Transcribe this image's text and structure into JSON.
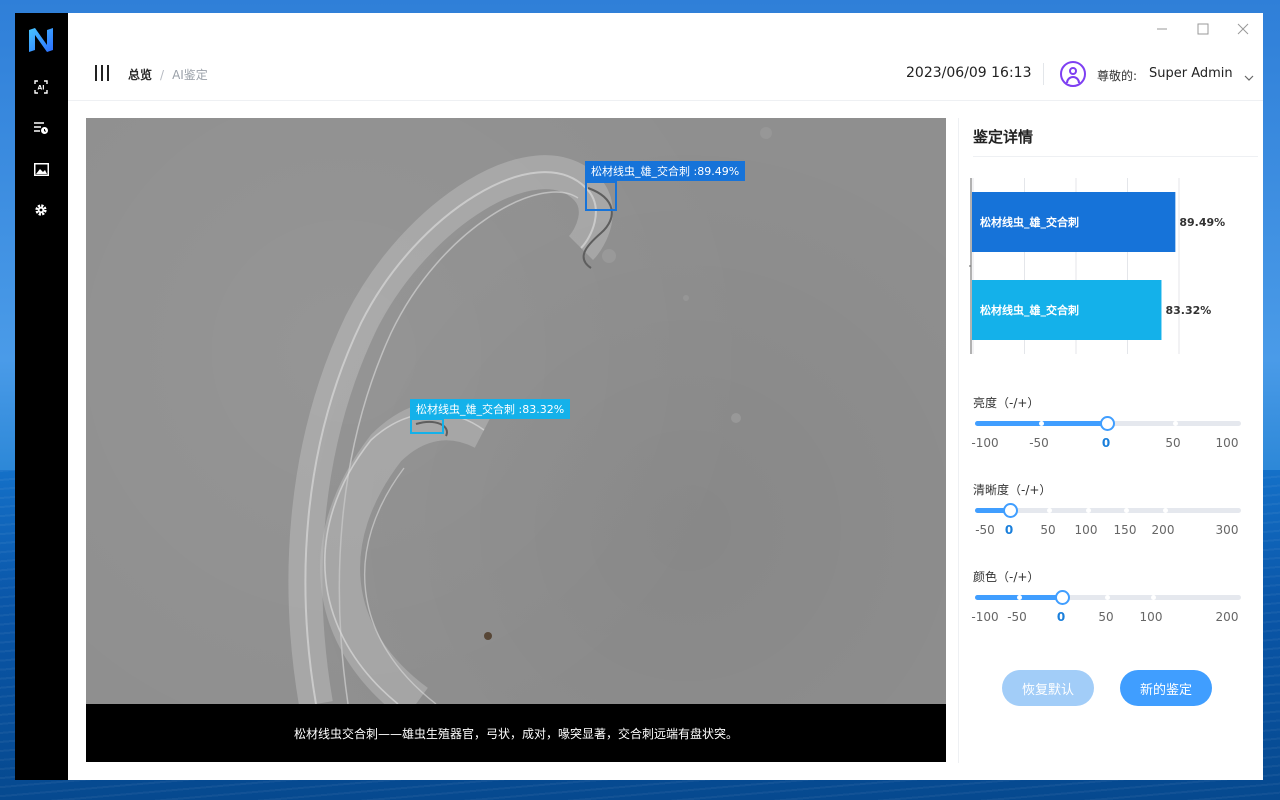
{
  "header": {
    "breadcrumb": [
      "总览",
      "AI鉴定"
    ],
    "datetime": "2023/06/09 16:13",
    "user_greeting": "尊敬的:",
    "user_name": "Super Admin"
  },
  "sidebar": {
    "items": [
      {
        "icon": "ai-scan-icon"
      },
      {
        "icon": "history-list-icon"
      },
      {
        "icon": "image-icon"
      },
      {
        "icon": "gear-icon"
      }
    ]
  },
  "window_controls": [
    "minimize-icon",
    "maximize-icon",
    "close-icon"
  ],
  "viewer": {
    "detections": [
      {
        "label": "松材线虫_雄_交合刺 :89.49%",
        "color": "#1673d9"
      },
      {
        "label": "松材线虫_雄_交合刺 :83.32%",
        "color": "#14b1ea"
      }
    ],
    "caption": "松材线虫交合刺——雄虫生殖器官，弓状，成对，喙突显著，交合刺远端有盘状突。"
  },
  "panel": {
    "title": "鉴定详情",
    "sliders": [
      {
        "label": "亮度（-/+）",
        "ticks": [
          "-100",
          "-50",
          "0",
          "50",
          "100"
        ],
        "value": 0,
        "active_tick": "0"
      },
      {
        "label": "清晰度（-/+）",
        "ticks": [
          "-50",
          "0",
          "50",
          "100",
          "150",
          "200",
          "300"
        ],
        "value": 0,
        "active_tick": "0"
      },
      {
        "label": "颜色（-/+）",
        "ticks": [
          "-100",
          "-50",
          "0",
          "50",
          "100",
          "200"
        ],
        "value": 0,
        "active_tick": "0"
      }
    ],
    "buttons": {
      "reset": "恢复默认",
      "new": "新的鉴定"
    }
  },
  "chart_data": {
    "type": "bar",
    "orientation": "horizontal",
    "categories": [
      "松材线虫_雄_交合刺",
      "松材线虫_雄_交合刺"
    ],
    "values": [
      89.49,
      83.32
    ],
    "value_labels": [
      "89.49%",
      "83.32%"
    ],
    "colors": [
      "#1673d9",
      "#14b1ea"
    ],
    "xlim": [
      0,
      100
    ],
    "grid": true
  }
}
